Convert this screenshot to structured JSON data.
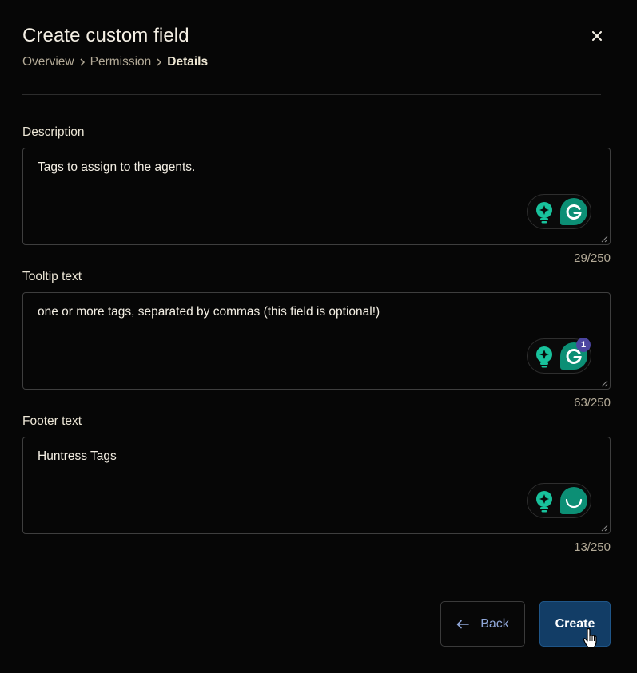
{
  "dialog": {
    "title": "Create custom field",
    "close_icon": "close-icon"
  },
  "breadcrumb": {
    "items": [
      "Overview",
      "Permission",
      "Details"
    ],
    "separator_icon": "chevron-right-icon"
  },
  "fields": [
    {
      "label": "Description",
      "value": "Tags to assign to the agents.",
      "counter": "29/250",
      "grammarly_badge": ""
    },
    {
      "label": "Tooltip text",
      "value": "one or more tags, separated by commas (this field is optional!)",
      "counter": "63/250",
      "grammarly_badge": "1"
    },
    {
      "label": "Footer text",
      "value": "Huntress Tags",
      "counter": "13/250",
      "grammarly_badge": ""
    }
  ],
  "footer": {
    "back_label": "Back",
    "back_icon": "arrow-left-icon",
    "create_label": "Create"
  },
  "colors": {
    "background": "#060606",
    "create_button": "#123d66",
    "back_text": "#8fa6d7",
    "grammarly_green": "#0c8f75",
    "grammarly_bulb": "#18c29c",
    "badge": "#4b45a0"
  }
}
